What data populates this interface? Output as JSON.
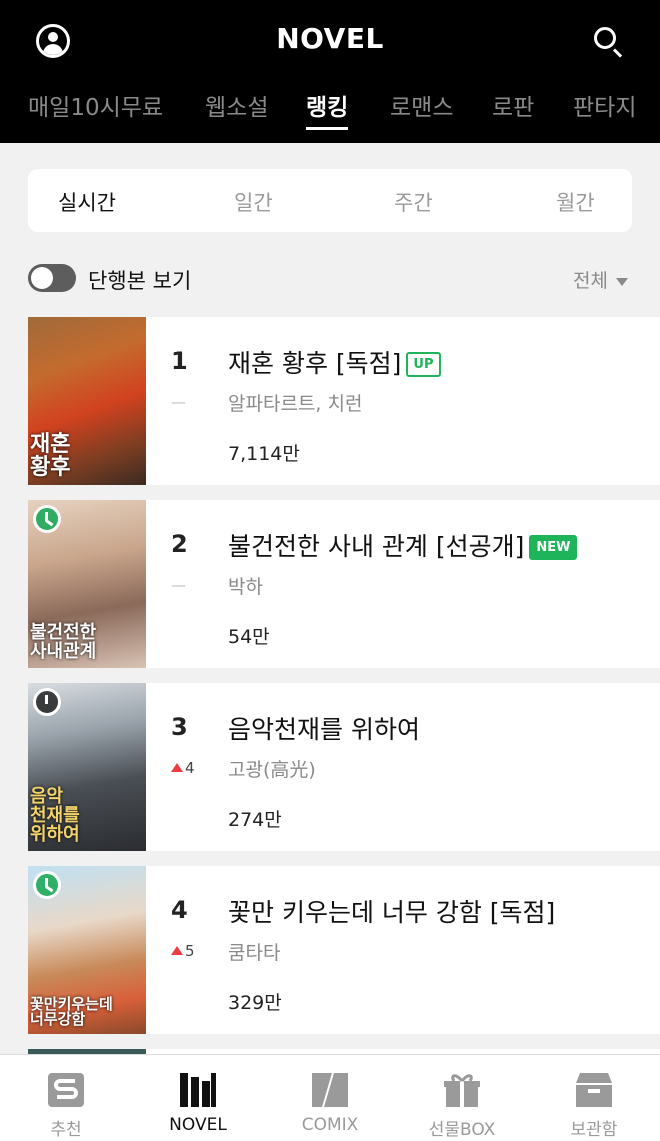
{
  "header": {
    "title": "NOVEL",
    "profile_icon": "profile-icon",
    "search_icon": "search-icon"
  },
  "nav_tabs": [
    {
      "label": "매일10시무료"
    },
    {
      "label": "웹소설"
    },
    {
      "label": "랭킹",
      "active": true
    },
    {
      "label": "로맨스"
    },
    {
      "label": "로판"
    },
    {
      "label": "판타지"
    }
  ],
  "period_tabs": [
    {
      "label": "실시간",
      "active": true
    },
    {
      "label": "일간"
    },
    {
      "label": "주간"
    },
    {
      "label": "월간"
    }
  ],
  "controls": {
    "toggle_label": "단행본 보기",
    "toggle_on": false,
    "filter_label": "전체"
  },
  "rankings": [
    {
      "rank": "1",
      "change": "—",
      "title": "재혼 황후 [독점]",
      "badge": "UP",
      "author": "알파타르트, 치런",
      "views": "7,114만",
      "cover_text": "재혼\n황후",
      "cover_icon": ""
    },
    {
      "rank": "2",
      "change": "—",
      "title": "불건전한 사내 관계 [선공개]",
      "badge": "NEW",
      "author": "박하",
      "views": "54만",
      "cover_text": "불건전한\n사내관계",
      "cover_icon": "clock-icon"
    },
    {
      "rank": "3",
      "change": "4",
      "title": "음악천재를 위하여",
      "badge": "",
      "author": "고광(高光)",
      "views": "274만",
      "cover_text": "음악\n천재를\n위하여",
      "cover_icon": "alarm-icon"
    },
    {
      "rank": "4",
      "change": "5",
      "title": "꽃만 키우는데 너무 강함 [독점]",
      "badge": "",
      "author": "쿰타타",
      "views": "329만",
      "cover_text": "꽃만키우는데\n너무강함",
      "cover_icon": "clock-icon"
    }
  ],
  "bottom_nav": [
    {
      "label": "추천",
      "icon": "s-logo-icon"
    },
    {
      "label": "NOVEL",
      "icon": "books-icon",
      "active": true
    },
    {
      "label": "COMIX",
      "icon": "comix-icon"
    },
    {
      "label": "선물BOX",
      "icon": "gift-icon"
    },
    {
      "label": "보관함",
      "icon": "storage-box-icon"
    }
  ],
  "colors": {
    "accent_green": "#1db45a",
    "rank_up_red": "#ef3c42",
    "header_bg": "#000000"
  }
}
